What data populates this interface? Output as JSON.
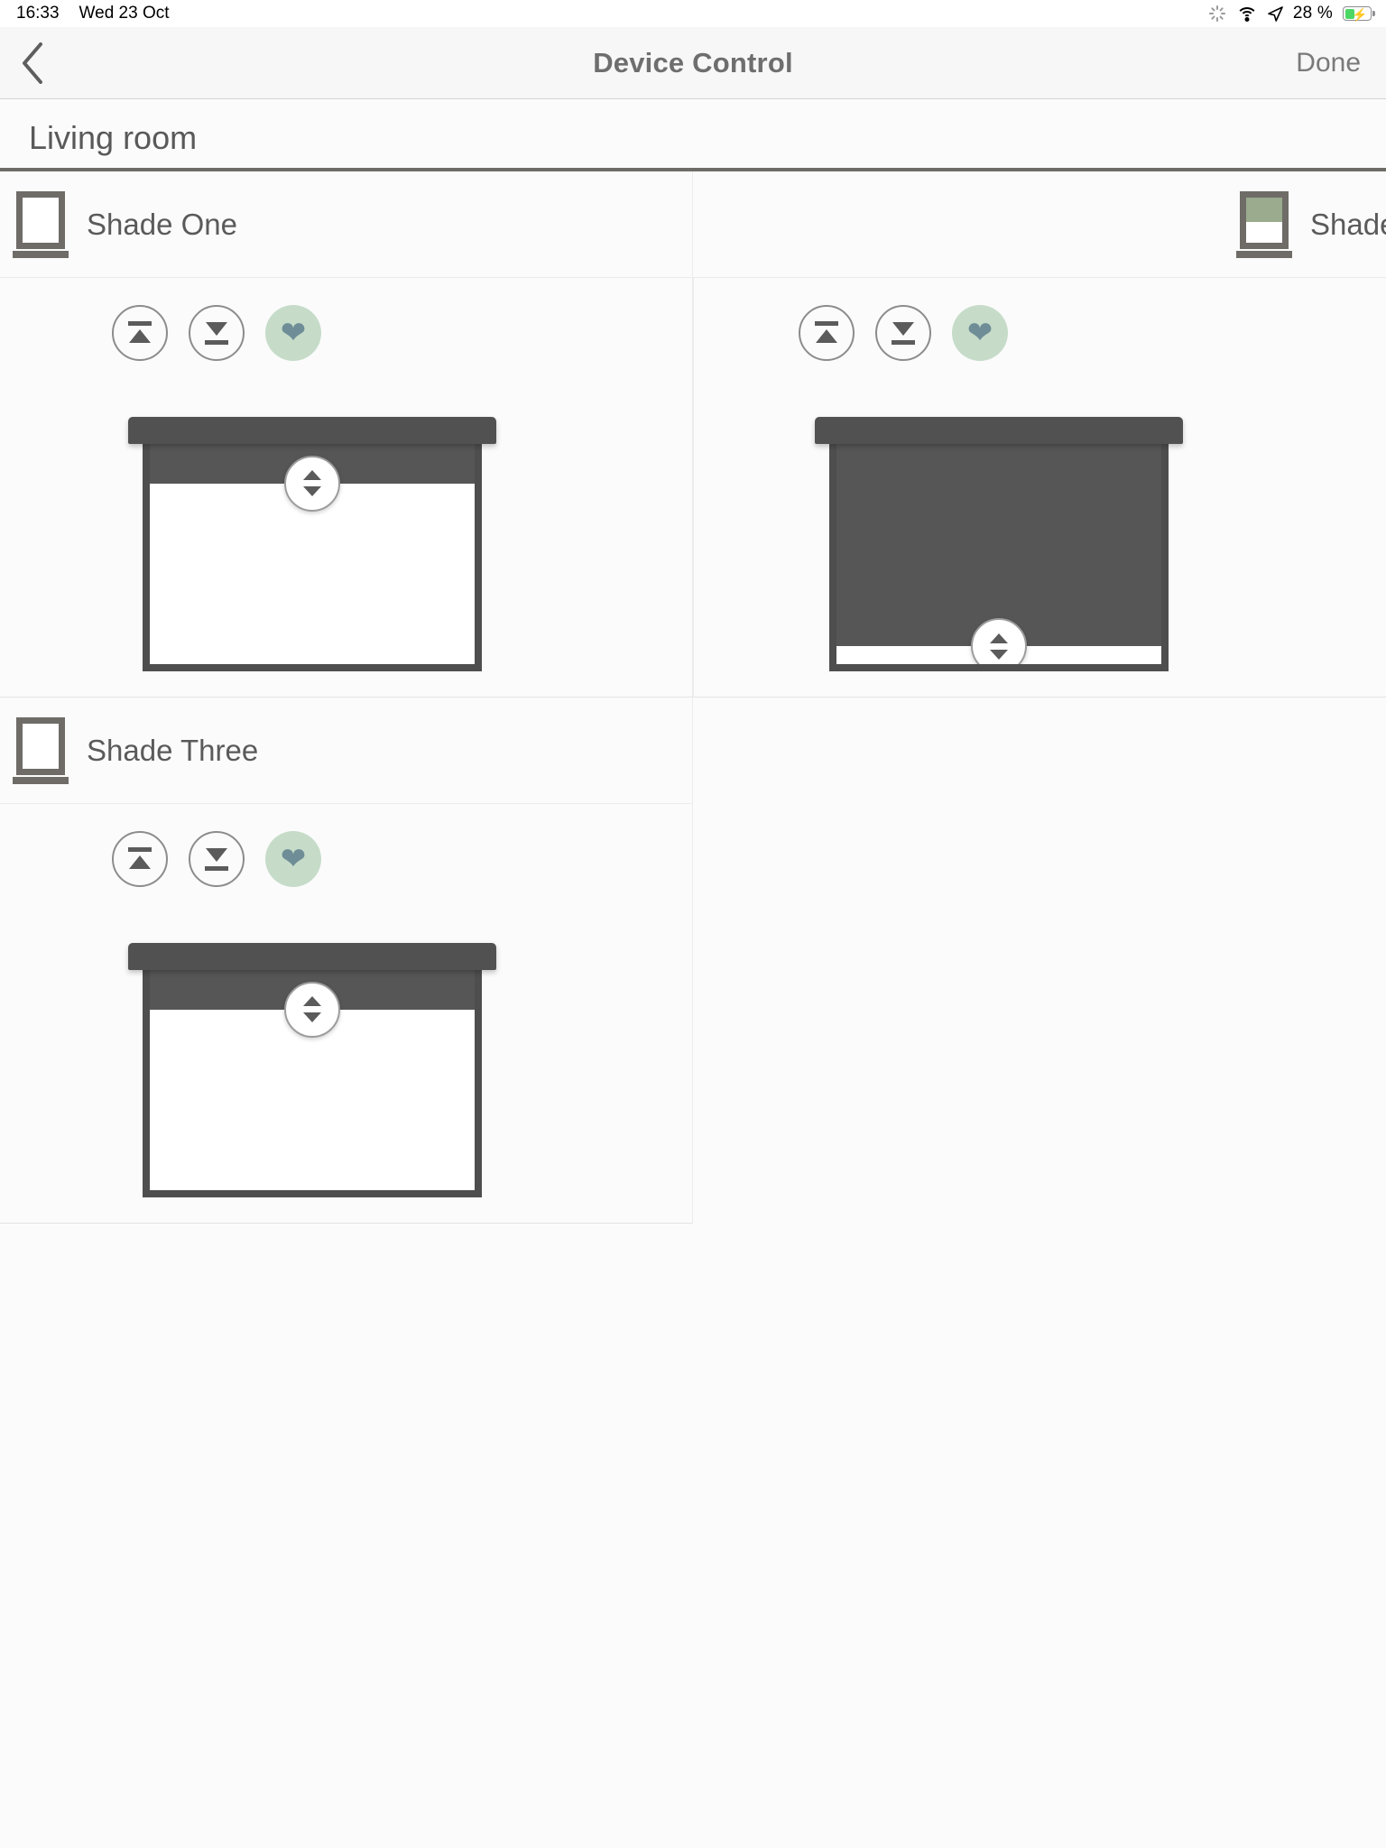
{
  "status_bar": {
    "time": "16:33",
    "date": "Wed 23 Oct",
    "battery_percent": "28 %",
    "icons": [
      "spinner-icon",
      "wifi-icon",
      "location-arrow-icon",
      "battery-charging-icon"
    ]
  },
  "nav": {
    "back_icon": "chevron-left-icon",
    "title": "Device Control",
    "done_label": "Done"
  },
  "room": {
    "title": "Living room"
  },
  "colors": {
    "accent_green": "#c6dcc9",
    "heart_teal": "#6e8d96",
    "shade_dark": "#565656",
    "frame_dark": "#4e4e4e",
    "thumb_fill": "#9aab8e",
    "battery_green": "#4cd764"
  },
  "controls": {
    "open_label": "Open",
    "close_label": "Close",
    "favorite_label": "Favorite",
    "open_icon": "shade-open-up-icon",
    "close_icon": "shade-close-down-icon",
    "favorite_icon": "heart-icon",
    "knob_icon": "up-down-stepper-icon"
  },
  "shades": [
    {
      "name": "Shade One",
      "thumb_icon": "window-shade-open-icon",
      "thumb_fill_percent": 0,
      "closed_percent": 18
    },
    {
      "name": "Shade Two",
      "thumb_icon": "window-shade-half-icon",
      "thumb_fill_percent": 55,
      "closed_percent": 92
    },
    {
      "name": "Shade Three",
      "thumb_icon": "window-shade-open-icon",
      "thumb_fill_percent": 0,
      "closed_percent": 18
    }
  ]
}
